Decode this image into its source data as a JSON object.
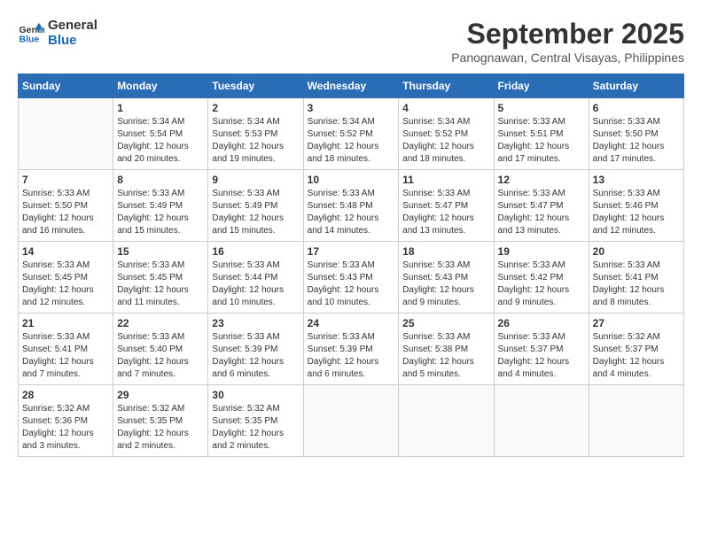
{
  "header": {
    "logo_line1": "General",
    "logo_line2": "Blue",
    "title": "September 2025",
    "subtitle": "Panognawan, Central Visayas, Philippines"
  },
  "calendar": {
    "days": [
      "Sunday",
      "Monday",
      "Tuesday",
      "Wednesday",
      "Thursday",
      "Friday",
      "Saturday"
    ],
    "weeks": [
      [
        {
          "date": "",
          "content": ""
        },
        {
          "date": "1",
          "content": "Sunrise: 5:34 AM\nSunset: 5:54 PM\nDaylight: 12 hours\nand 20 minutes."
        },
        {
          "date": "2",
          "content": "Sunrise: 5:34 AM\nSunset: 5:53 PM\nDaylight: 12 hours\nand 19 minutes."
        },
        {
          "date": "3",
          "content": "Sunrise: 5:34 AM\nSunset: 5:52 PM\nDaylight: 12 hours\nand 18 minutes."
        },
        {
          "date": "4",
          "content": "Sunrise: 5:34 AM\nSunset: 5:52 PM\nDaylight: 12 hours\nand 18 minutes."
        },
        {
          "date": "5",
          "content": "Sunrise: 5:33 AM\nSunset: 5:51 PM\nDaylight: 12 hours\nand 17 minutes."
        },
        {
          "date": "6",
          "content": "Sunrise: 5:33 AM\nSunset: 5:50 PM\nDaylight: 12 hours\nand 17 minutes."
        }
      ],
      [
        {
          "date": "7",
          "content": "Sunrise: 5:33 AM\nSunset: 5:50 PM\nDaylight: 12 hours\nand 16 minutes."
        },
        {
          "date": "8",
          "content": "Sunrise: 5:33 AM\nSunset: 5:49 PM\nDaylight: 12 hours\nand 15 minutes."
        },
        {
          "date": "9",
          "content": "Sunrise: 5:33 AM\nSunset: 5:49 PM\nDaylight: 12 hours\nand 15 minutes."
        },
        {
          "date": "10",
          "content": "Sunrise: 5:33 AM\nSunset: 5:48 PM\nDaylight: 12 hours\nand 14 minutes."
        },
        {
          "date": "11",
          "content": "Sunrise: 5:33 AM\nSunset: 5:47 PM\nDaylight: 12 hours\nand 13 minutes."
        },
        {
          "date": "12",
          "content": "Sunrise: 5:33 AM\nSunset: 5:47 PM\nDaylight: 12 hours\nand 13 minutes."
        },
        {
          "date": "13",
          "content": "Sunrise: 5:33 AM\nSunset: 5:46 PM\nDaylight: 12 hours\nand 12 minutes."
        }
      ],
      [
        {
          "date": "14",
          "content": "Sunrise: 5:33 AM\nSunset: 5:45 PM\nDaylight: 12 hours\nand 12 minutes."
        },
        {
          "date": "15",
          "content": "Sunrise: 5:33 AM\nSunset: 5:45 PM\nDaylight: 12 hours\nand 11 minutes."
        },
        {
          "date": "16",
          "content": "Sunrise: 5:33 AM\nSunset: 5:44 PM\nDaylight: 12 hours\nand 10 minutes."
        },
        {
          "date": "17",
          "content": "Sunrise: 5:33 AM\nSunset: 5:43 PM\nDaylight: 12 hours\nand 10 minutes."
        },
        {
          "date": "18",
          "content": "Sunrise: 5:33 AM\nSunset: 5:43 PM\nDaylight: 12 hours\nand 9 minutes."
        },
        {
          "date": "19",
          "content": "Sunrise: 5:33 AM\nSunset: 5:42 PM\nDaylight: 12 hours\nand 9 minutes."
        },
        {
          "date": "20",
          "content": "Sunrise: 5:33 AM\nSunset: 5:41 PM\nDaylight: 12 hours\nand 8 minutes."
        }
      ],
      [
        {
          "date": "21",
          "content": "Sunrise: 5:33 AM\nSunset: 5:41 PM\nDaylight: 12 hours\nand 7 minutes."
        },
        {
          "date": "22",
          "content": "Sunrise: 5:33 AM\nSunset: 5:40 PM\nDaylight: 12 hours\nand 7 minutes."
        },
        {
          "date": "23",
          "content": "Sunrise: 5:33 AM\nSunset: 5:39 PM\nDaylight: 12 hours\nand 6 minutes."
        },
        {
          "date": "24",
          "content": "Sunrise: 5:33 AM\nSunset: 5:39 PM\nDaylight: 12 hours\nand 6 minutes."
        },
        {
          "date": "25",
          "content": "Sunrise: 5:33 AM\nSunset: 5:38 PM\nDaylight: 12 hours\nand 5 minutes."
        },
        {
          "date": "26",
          "content": "Sunrise: 5:33 AM\nSunset: 5:37 PM\nDaylight: 12 hours\nand 4 minutes."
        },
        {
          "date": "27",
          "content": "Sunrise: 5:32 AM\nSunset: 5:37 PM\nDaylight: 12 hours\nand 4 minutes."
        }
      ],
      [
        {
          "date": "28",
          "content": "Sunrise: 5:32 AM\nSunset: 5:36 PM\nDaylight: 12 hours\nand 3 minutes."
        },
        {
          "date": "29",
          "content": "Sunrise: 5:32 AM\nSunset: 5:35 PM\nDaylight: 12 hours\nand 2 minutes."
        },
        {
          "date": "30",
          "content": "Sunrise: 5:32 AM\nSunset: 5:35 PM\nDaylight: 12 hours\nand 2 minutes."
        },
        {
          "date": "",
          "content": ""
        },
        {
          "date": "",
          "content": ""
        },
        {
          "date": "",
          "content": ""
        },
        {
          "date": "",
          "content": ""
        }
      ]
    ]
  }
}
